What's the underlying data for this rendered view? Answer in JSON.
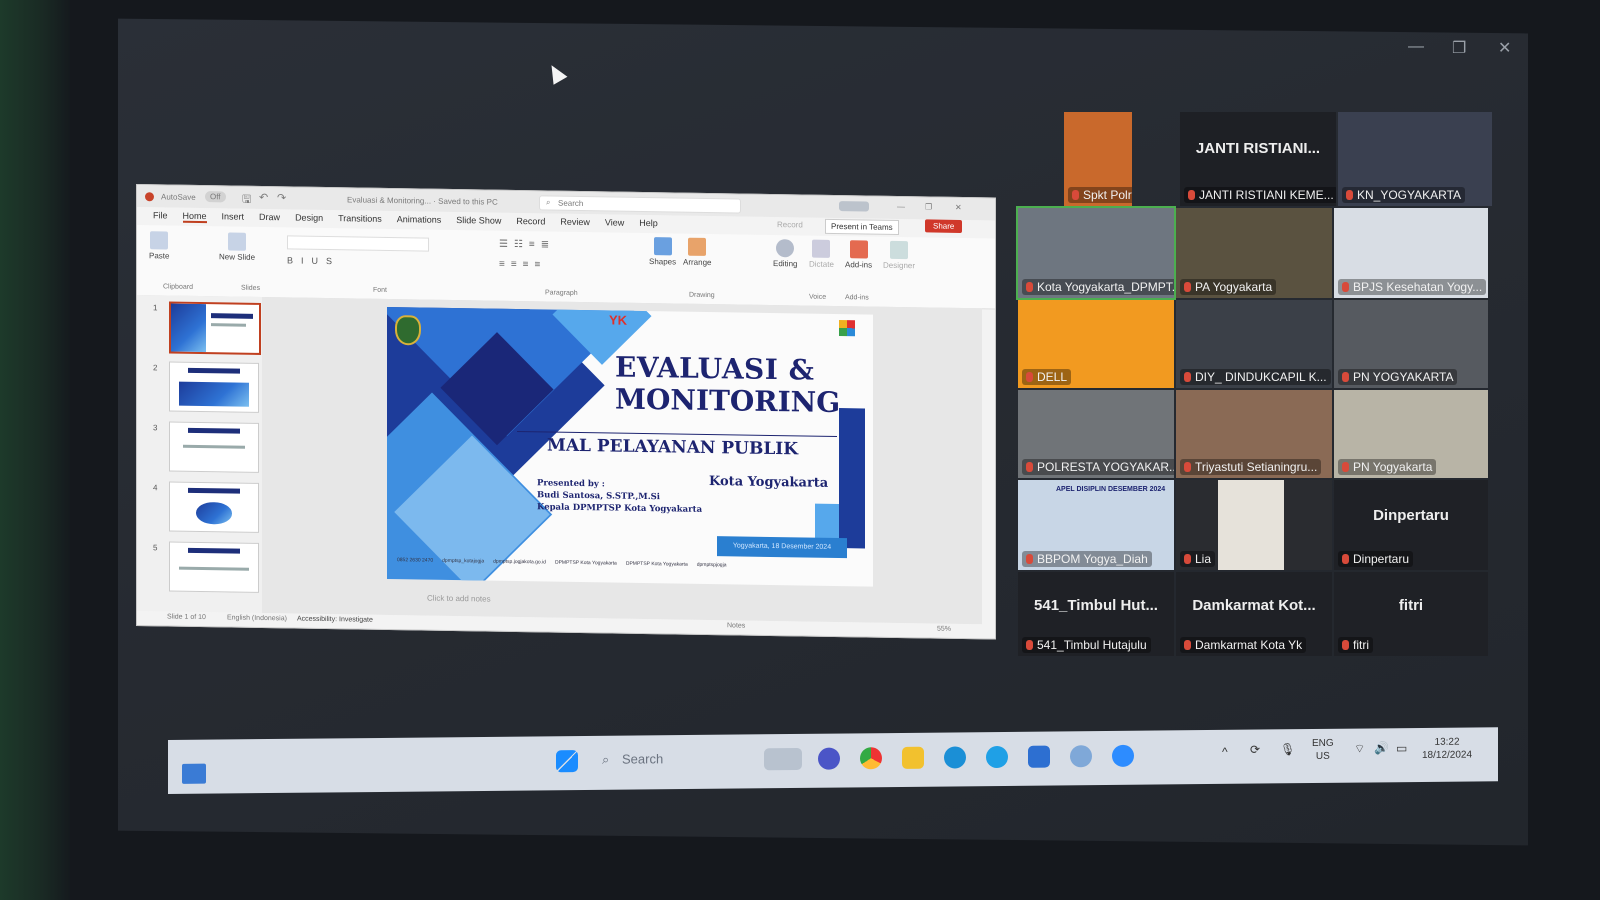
{
  "window_controls": {
    "minimize": "—",
    "restore": "❐",
    "close": "✕"
  },
  "powerpoint": {
    "titlebar": {
      "autosave": "AutoSave",
      "toggle": "Off",
      "filename": "Evaluasi & Monitoring... · Saved to this PC",
      "search": "Search"
    },
    "menu": [
      "File",
      "Home",
      "Insert",
      "Draw",
      "Design",
      "Transitions",
      "Animations",
      "Slide Show",
      "Record",
      "Review",
      "View",
      "Help"
    ],
    "actions": {
      "record": "Record",
      "present_teams": "Present in Teams",
      "share": "Share"
    },
    "ribbon": {
      "paste": "Paste",
      "new_slide": "New Slide",
      "shapes": "Shapes",
      "arrange": "Arrange",
      "editing": "Editing",
      "dictate": "Dictate",
      "addins": "Add-ins",
      "designer": "Designer",
      "groups": [
        "Clipboard",
        "Slides",
        "Font",
        "Paragraph",
        "Drawing",
        "Voice",
        "Add-ins"
      ]
    },
    "thumb_numbers": [
      "1",
      "2",
      "3",
      "4",
      "5"
    ],
    "notes_placeholder": "Click to add notes",
    "status": {
      "slide": "Slide 1 of 10",
      "language": "English (Indonesia)",
      "accessibility": "Accessibility: Investigate",
      "notes": "Notes",
      "zoom": "55%"
    },
    "slide": {
      "badge": "YK",
      "title_line1": "EVALUASI &",
      "title_line2": "MONITORING",
      "subtitle": "MAL PELAYANAN PUBLIK",
      "presented_by": "Presented by :",
      "presenter": "Budi Santosa, S.STP.,M.Si",
      "position": "Kepala DPMPTSP Kota Yogyakarta",
      "city": "Kota Yogyakarta",
      "date": "Yogyakarta, 18 Desember 2024",
      "footer": [
        "0852 2630 2470",
        "dpmptsp_kotajogja",
        "dpmptsp.jogjakota.go.id",
        "DPMPTSP Kota Yogyakarta",
        "DPMPTSP Kota Yogyakarta",
        "dpmptspjogja"
      ]
    }
  },
  "teams": {
    "tiles": [
      {
        "label": "Spkt Polresta Yogyak...",
        "big": ""
      },
      {
        "label": "JANTI RISTIANI KEME...",
        "big": "JANTI RISTIANI..."
      },
      {
        "label": "KN_YOGYAKARTA",
        "big": ""
      },
      {
        "label": "Kota Yogyakarta_DPMPT...",
        "big": ""
      },
      {
        "label": "PA Yogyakarta",
        "big": ""
      },
      {
        "label": "BPJS Kesehatan Yogy...",
        "big": ""
      },
      {
        "label": "DELL",
        "big": ""
      },
      {
        "label": "DIY_ DINDUKCAPIL K...",
        "big": ""
      },
      {
        "label": "PN YOGYAKARTA",
        "big": ""
      },
      {
        "label": "POLRESTA YOGYAKAR...",
        "big": ""
      },
      {
        "label": "Triyastuti Setianingru...",
        "big": ""
      },
      {
        "label": "PN Yogyakarta",
        "big": ""
      },
      {
        "label": "BBPOM Yogya_Diah",
        "big": ""
      },
      {
        "label": "Lia",
        "big": ""
      },
      {
        "label": "Dinpertaru",
        "big": "Dinpertaru"
      },
      {
        "label": "541_Timbul Hutajulu",
        "big": "541_Timbul Hut..."
      },
      {
        "label": "Damkarmat Kota Yk",
        "big": "Damkarmat Kot..."
      },
      {
        "label": "fitri",
        "big": "fitri"
      }
    ],
    "apel_text": "APEL DISIPLIN DESEMBER 2024"
  },
  "taskbar": {
    "search": "Search",
    "lang_top": "ENG",
    "lang_bottom": "US",
    "time": "13:22",
    "date": "18/12/2024"
  },
  "colors": {
    "slide_navy": "#1d2470",
    "slide_blue": "#2e72d4",
    "teams_bg": "#1f2126",
    "share_red": "#d0382a"
  }
}
